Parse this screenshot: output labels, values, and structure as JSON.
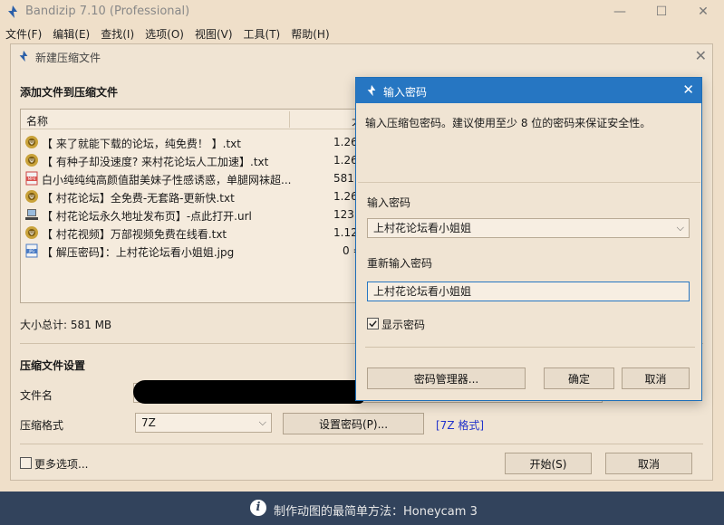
{
  "app": {
    "title": "Bandizip 7.10 (Professional)",
    "window_controls": {
      "minimize": "—",
      "maximize": "☐",
      "close": "✕"
    }
  },
  "menu": [
    "文件(F)",
    "编辑(E)",
    "查找(I)",
    "选项(O)",
    "视图(V)",
    "工具(T)",
    "帮助(H)"
  ],
  "new_archive_dialog": {
    "title": "新建压缩文件",
    "close": "✕",
    "add_files_heading": "添加文件到压缩文件",
    "file_list": {
      "columns": {
        "name": "名称",
        "size": "大"
      },
      "rows": [
        {
          "icon": "app-icon",
          "name": "【 来了就能下载的论坛，纯免费！ 】.txt",
          "size": "1.26"
        },
        {
          "icon": "app-icon",
          "name": "【 有种子却没速度? 来村花论坛人工加速】.txt",
          "size": "1.26"
        },
        {
          "icon": "mp4-icon",
          "name": "白小纯纯纯高颜值甜美妹子性感诱惑，单腿网袜超...",
          "size": "581"
        },
        {
          "icon": "app-icon",
          "name": "【 村花论坛】全免费-无套路-更新快.txt",
          "size": "1.26"
        },
        {
          "icon": "url-icon",
          "name": "【 村花论坛永久地址发布页】-点此打开.url",
          "size": "123 ="
        },
        {
          "icon": "app-icon",
          "name": "【 村花视频】万部视频免费在线看.txt",
          "size": "1.12"
        },
        {
          "icon": "jpg-icon",
          "name": "【 解压密码】：上村花论坛看小姐姐.jpg",
          "size": "0 ="
        }
      ]
    },
    "total_size": "大小总计: 581 MB",
    "settings_heading": "压缩文件设置",
    "filename_label": "文件名",
    "format_label": "压缩格式",
    "format_value": "7Z",
    "set_password_button": "设置密码(P)...",
    "format_link": "[7Z 格式]",
    "more_options_label": "更多选项...",
    "start_button": "开始(S)",
    "cancel_button": "取消"
  },
  "password_dialog": {
    "title": "输入密码",
    "close": "✕",
    "hint": "输入压缩包密码。建议使用至少 8 位的密码来保证安全性。",
    "password_label": "输入密码",
    "password_value": "上村花论坛看小姐姐",
    "confirm_label": "重新输入密码",
    "confirm_value": "上村花论坛看小姐姐",
    "show_password_label": "显示密码",
    "show_password_checked": true,
    "manager_button": "密码管理器...",
    "ok_button": "确定",
    "cancel_button": "取消"
  },
  "banner": {
    "icon_glyph": "i",
    "text": "制作动图的最简单方法：Honeycam 3"
  },
  "colors": {
    "window_bg": "#efdfc9",
    "accent_titlebar": "#2676c2",
    "banner_bg": "#32435c",
    "link": "#2233cc"
  }
}
